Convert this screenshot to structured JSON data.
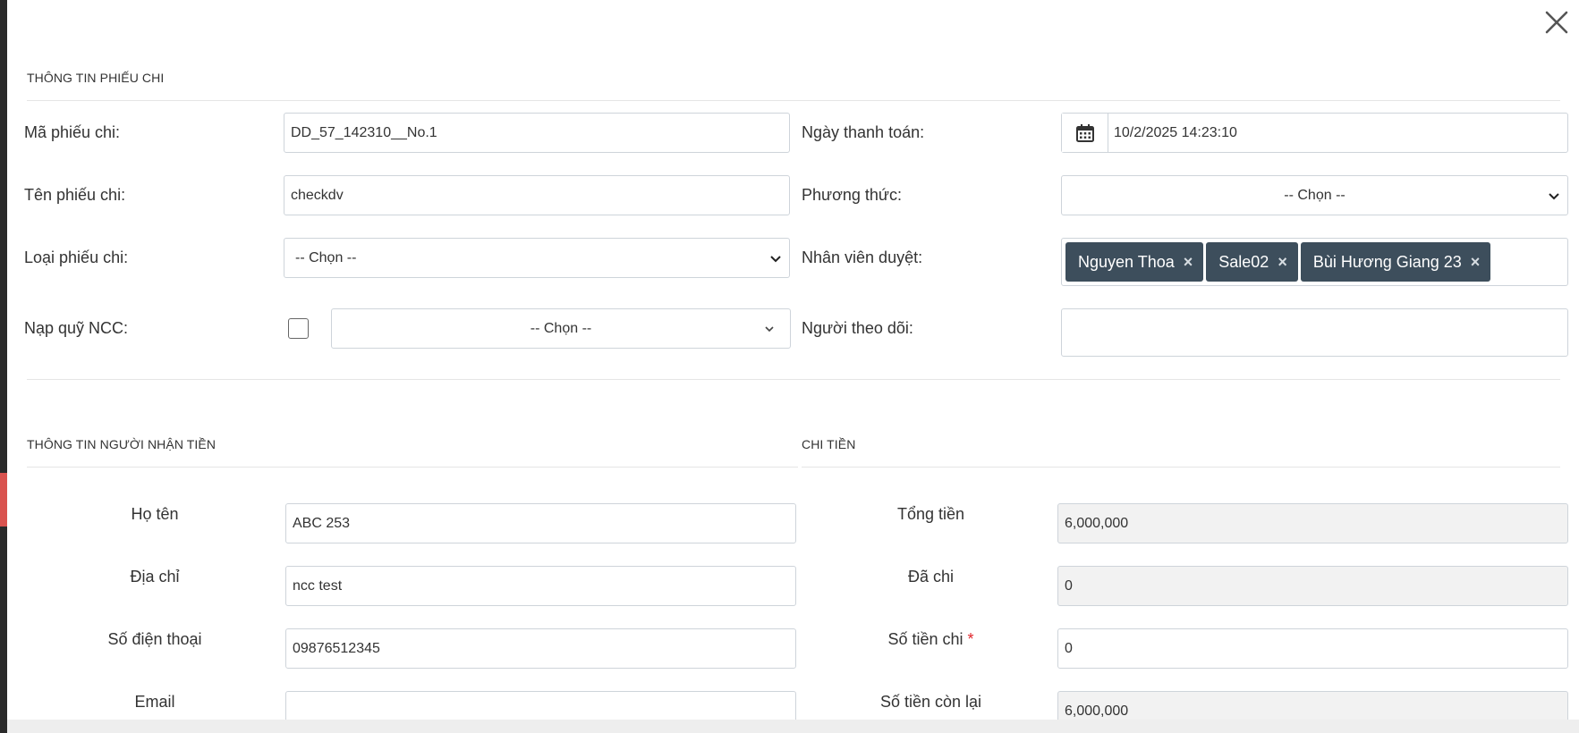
{
  "sections": {
    "payment_info": "THÔNG TIN PHIẾU CHI",
    "receiver_info": "THÔNG TIN NGƯỜI NHẬN TIỀN",
    "payout": "CHI TIỀN"
  },
  "form": {
    "voucher_code": {
      "label": "Mã phiếu chi:",
      "value": "DD_57_142310__No.1"
    },
    "voucher_name": {
      "label": "Tên phiếu chi:",
      "value": "checkdv"
    },
    "voucher_type": {
      "label": "Loại phiếu chi:",
      "selected": "-- Chọn --"
    },
    "supplier_fund": {
      "label": "Nạp quỹ NCC:",
      "selected": "-- Chọn --"
    },
    "payment_date": {
      "label": "Ngày thanh toán:",
      "value": "10/2/2025 14:23:10"
    },
    "method": {
      "label": "Phương thức:",
      "selected": "-- Chọn --"
    },
    "approvers": {
      "label": "Nhân viên duyệt:",
      "tags": [
        "Nguyen Thoa",
        "Sale02",
        "Bùi Hương Giang 23"
      ],
      "remove_glyph": "×"
    },
    "followers": {
      "label": "Người theo dõi:",
      "value": ""
    }
  },
  "receiver": {
    "name": {
      "label": "Họ tên",
      "value": "ABC 253"
    },
    "address": {
      "label": "Địa chỉ",
      "value": "ncc test"
    },
    "phone": {
      "label": "Số điện thoại",
      "value": "09876512345"
    },
    "email": {
      "label": "Email",
      "value": ""
    }
  },
  "payout": {
    "total": {
      "label": "Tổng tiền",
      "value": "6,000,000"
    },
    "paid": {
      "label": "Đã chi",
      "value": "0"
    },
    "amount": {
      "label": "Số tiền chi",
      "required": "*",
      "value": "0"
    },
    "remaining": {
      "label": "Số tiền còn lại",
      "value": "6,000,000"
    }
  },
  "icons": {
    "close": "close-icon",
    "calendar": "calendar-icon",
    "caret": "chevron-down-icon"
  }
}
